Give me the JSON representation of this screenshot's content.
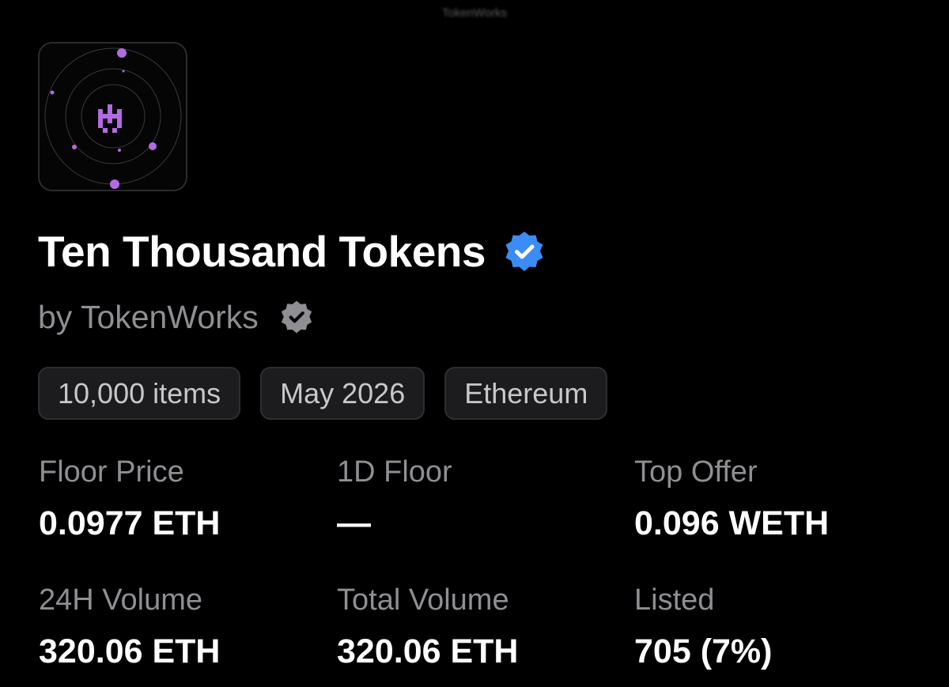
{
  "header": {
    "top_label": "TokenWorks"
  },
  "collection": {
    "avatar_icon": "orbit-invader-logo-icon",
    "name": "Ten Thousand Tokens",
    "verified_icon": "verified-badge-icon",
    "creator": "by TokenWorks",
    "creator_badge_icon": "verified-badge-icon",
    "colors": {
      "accent_purple": "#b36ae2",
      "verified_blue": "#3b8cf5",
      "creator_badge_gray": "#8e8e93"
    }
  },
  "chips": [
    {
      "label": "10,000 items"
    },
    {
      "label": "May 2026"
    },
    {
      "label": "Ethereum"
    }
  ],
  "stats": [
    {
      "label": "Floor Price",
      "value": "0.0977 ETH"
    },
    {
      "label": "1D Floor",
      "value": "—"
    },
    {
      "label": "Top Offer",
      "value": "0.096 WETH"
    },
    {
      "label": "24H Volume",
      "value": "320.06 ETH"
    },
    {
      "label": "Total Volume",
      "value": "320.06 ETH"
    },
    {
      "label": "Listed",
      "value": "705 (7%)"
    }
  ]
}
